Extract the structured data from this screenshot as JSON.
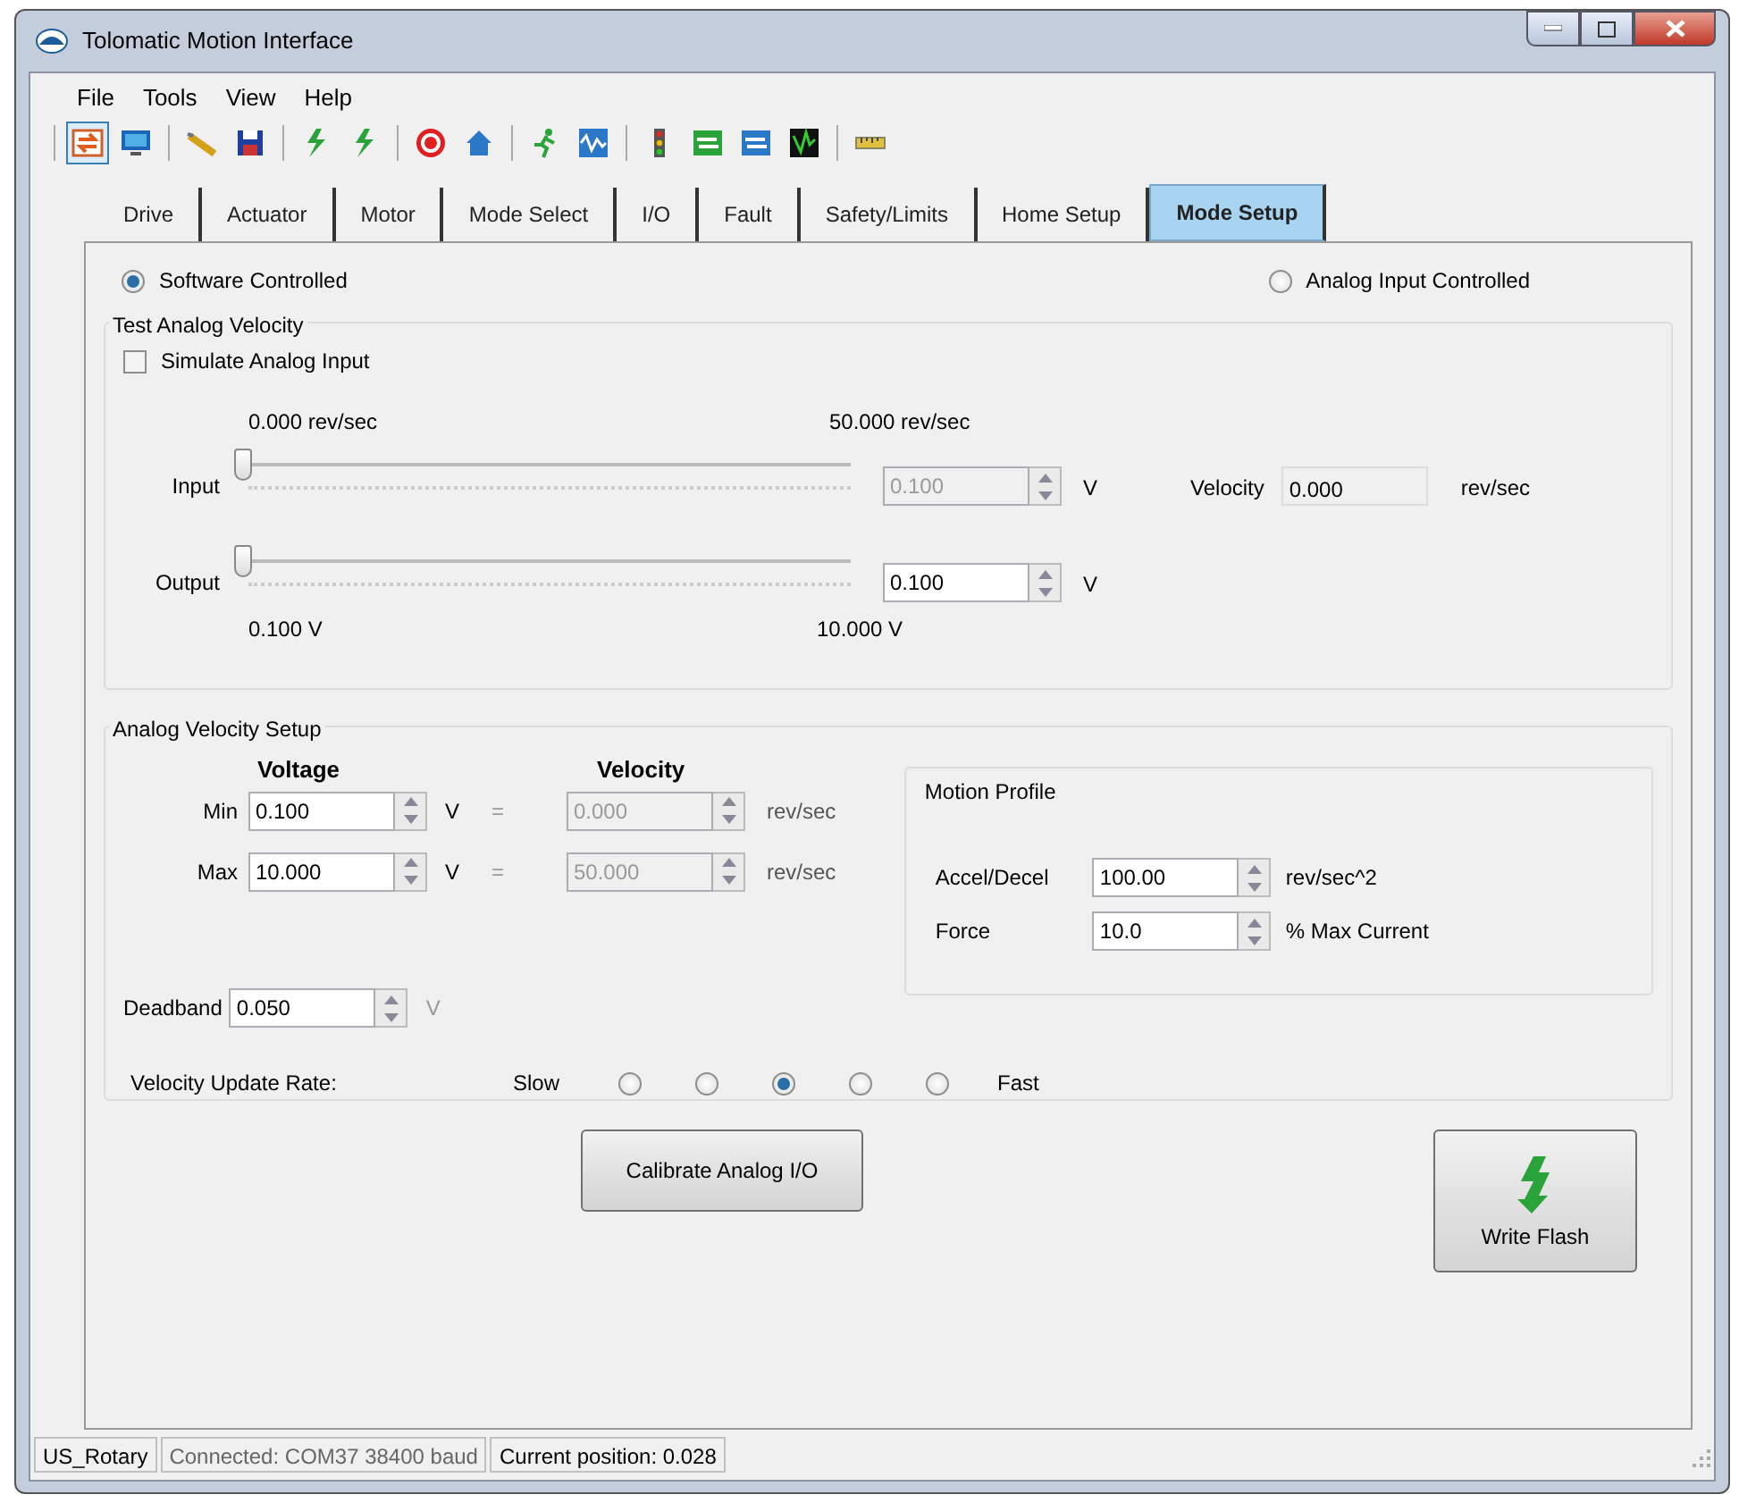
{
  "window": {
    "title": "Tolomatic Motion Interface"
  },
  "menu": [
    "File",
    "Tools",
    "View",
    "Help"
  ],
  "toolbar": [
    {
      "selected": true
    },
    {
      "selected": false
    },
    {
      "selected": false
    },
    {
      "selected": false
    },
    {
      "selected": false
    },
    {
      "selected": false
    },
    {
      "selected": false
    },
    {
      "selected": false
    },
    {
      "selected": false
    },
    {
      "selected": false
    },
    {
      "selected": false
    },
    {
      "selected": false
    },
    {
      "selected": false
    },
    {
      "selected": false
    },
    {
      "selected": false
    }
  ],
  "tabs": [
    {
      "label": "Drive",
      "selected": false
    },
    {
      "label": "Actuator",
      "selected": false
    },
    {
      "label": "Motor",
      "selected": false
    },
    {
      "label": "Mode Select",
      "selected": false
    },
    {
      "label": "I/O",
      "selected": false
    },
    {
      "label": "Fault",
      "selected": false
    },
    {
      "label": "Safety/Limits",
      "selected": false
    },
    {
      "label": "Home Setup",
      "selected": false
    },
    {
      "label": "Mode Setup",
      "selected": true
    }
  ],
  "control_mode": [
    {
      "label": "Software Controlled",
      "selected": true
    },
    {
      "label": "Analog Input Controlled",
      "selected": false
    }
  ],
  "test_analog_velocity": {
    "title": "Test Analog Velocity",
    "simulate": {
      "label": "Simulate Analog Input",
      "checked": false
    },
    "min_label": "0.000 rev/sec",
    "max_label": "50.000 rev/sec",
    "input": {
      "label": "Input",
      "level": 0,
      "value": "0.100",
      "disabled": true,
      "unit": "V"
    },
    "velocity": {
      "label": "Velocity",
      "value": "0.000",
      "unit": "rev/sec"
    },
    "output": {
      "label": "Output",
      "level": 0,
      "value": "0.100",
      "disabled": false,
      "unit": "V"
    },
    "output_min_label": "0.100 V",
    "output_max_label": "10.000 V"
  },
  "analog_velocity_setup": {
    "title": "Analog Velocity Setup",
    "voltage_header": "Voltage",
    "velocity_header": "Velocity",
    "rows": [
      {
        "label": "Min",
        "voltage": "0.100",
        "voltage_unit": "V",
        "equals": "=",
        "velocity": "0.000",
        "velocity_disabled": true,
        "velocity_unit": "rev/sec"
      },
      {
        "label": "Max",
        "voltage": "10.000",
        "voltage_unit": "V",
        "equals": "=",
        "velocity": "50.000",
        "velocity_disabled": true,
        "velocity_unit": "rev/sec"
      }
    ],
    "motion_profile": {
      "title": "Motion Profile",
      "rows": [
        {
          "label": "Accel/Decel",
          "value": "100.00",
          "unit": "rev/sec^2"
        },
        {
          "label": "Force",
          "value": "10.0",
          "unit": "% Max Current"
        }
      ]
    },
    "deadband": {
      "label": "Deadband",
      "value": "0.050",
      "unit": "V"
    },
    "update_rate": {
      "label": "Velocity Update Rate:",
      "slow": "Slow",
      "fast": "Fast",
      "options": [
        {
          "selected": false
        },
        {
          "selected": false
        },
        {
          "selected": true
        },
        {
          "selected": false
        },
        {
          "selected": false
        }
      ]
    }
  },
  "buttons": {
    "calibrate": "Calibrate Analog I/O",
    "write_flash": "Write Flash"
  },
  "status_bar": [
    "US_Rotary",
    "Connected: COM37 38400 baud",
    "Current position: 0.028"
  ]
}
